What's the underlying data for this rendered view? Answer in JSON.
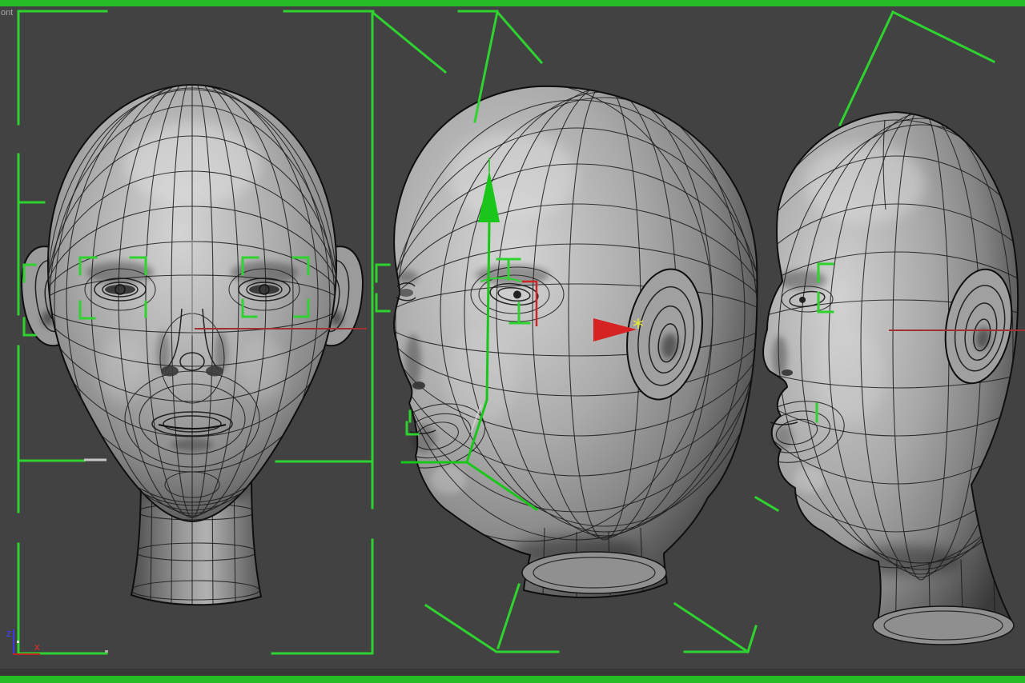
{
  "viewport": {
    "label_visible_text": "ont",
    "background_color": "#424242",
    "frame_bar_color": "#25bc25"
  },
  "world_axis": {
    "z_label": "Z",
    "x_label": "X",
    "z_color": "#3b3be0",
    "x_color": "#c42222"
  },
  "overlay_colors": {
    "selection_green": "#2fd32f",
    "gizmo_green": "#19c619",
    "edge_red": "#a33030",
    "arrow_red": "#d62222",
    "vertex_yellow": "#e6e63a",
    "helper_white": "#c8c8c8"
  },
  "scene": {
    "objects": [
      {
        "name": "head-front-view"
      },
      {
        "name": "head-three-quarter-view"
      },
      {
        "name": "head-profile-view"
      }
    ]
  }
}
